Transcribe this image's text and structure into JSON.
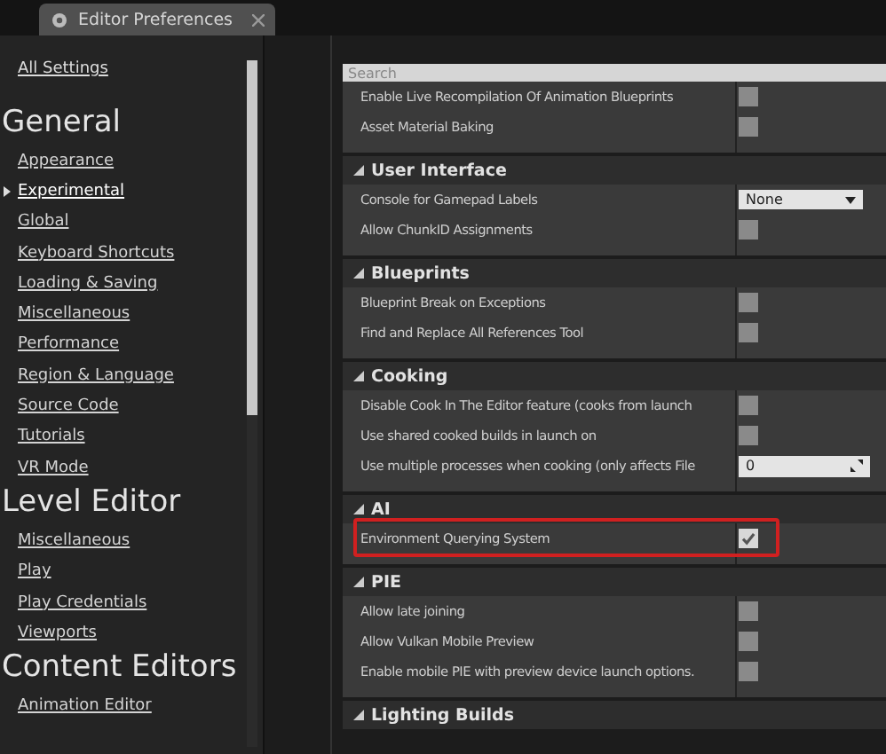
{
  "window": {
    "title": "Editor Preferences"
  },
  "sidebar": {
    "top_link": "All Settings",
    "groups": [
      {
        "heading": "General",
        "items": [
          {
            "label": "Appearance",
            "selected": false
          },
          {
            "label": "Experimental",
            "selected": true
          },
          {
            "label": "Global",
            "selected": false
          },
          {
            "label": "Keyboard Shortcuts",
            "selected": false
          },
          {
            "label": "Loading & Saving",
            "selected": false
          },
          {
            "label": "Miscellaneous",
            "selected": false
          },
          {
            "label": "Performance",
            "selected": false
          },
          {
            "label": "Region & Language",
            "selected": false
          },
          {
            "label": "Source Code",
            "selected": false
          },
          {
            "label": "Tutorials",
            "selected": false
          },
          {
            "label": "VR Mode",
            "selected": false
          }
        ]
      },
      {
        "heading": "Level Editor",
        "items": [
          {
            "label": "Miscellaneous",
            "selected": false
          },
          {
            "label": "Play",
            "selected": false
          },
          {
            "label": "Play Credentials",
            "selected": false
          },
          {
            "label": "Viewports",
            "selected": false
          }
        ]
      },
      {
        "heading": "Content Editors",
        "items": [
          {
            "label": "Animation Editor",
            "selected": false
          }
        ]
      }
    ]
  },
  "search": {
    "placeholder": "Search"
  },
  "sections": [
    {
      "rows": [
        {
          "label": "Enable Live Recompilation Of Animation Blueprints",
          "kind": "checkbox",
          "checked": false,
          "highlighted": false
        },
        {
          "label": "Asset Material Baking",
          "kind": "checkbox",
          "checked": false,
          "highlighted": false
        }
      ]
    },
    {
      "title": "User Interface",
      "rows": [
        {
          "label": "Console for Gamepad Labels",
          "kind": "dropdown",
          "value": "None",
          "highlighted": false
        },
        {
          "label": "Allow ChunkID Assignments",
          "kind": "checkbox",
          "checked": false,
          "highlighted": false
        }
      ]
    },
    {
      "title": "Blueprints",
      "rows": [
        {
          "label": "Blueprint Break on Exceptions",
          "kind": "checkbox",
          "checked": false,
          "highlighted": false
        },
        {
          "label": "Find and Replace All References Tool",
          "kind": "checkbox",
          "checked": false,
          "highlighted": false
        }
      ]
    },
    {
      "title": "Cooking",
      "rows": [
        {
          "label": "Disable Cook In The Editor feature (cooks from launch",
          "kind": "checkbox",
          "checked": false,
          "highlighted": false
        },
        {
          "label": "Use shared cooked builds in launch on",
          "kind": "checkbox",
          "checked": false,
          "highlighted": false
        },
        {
          "label": "Use multiple processes when cooking (only affects File",
          "kind": "number",
          "value": "0",
          "highlighted": false
        }
      ]
    },
    {
      "title": "AI",
      "rows": [
        {
          "label": "Environment Querying System",
          "kind": "checkbox",
          "checked": true,
          "highlighted": true
        }
      ]
    },
    {
      "title": "PIE",
      "rows": [
        {
          "label": "Allow late joining",
          "kind": "checkbox",
          "checked": false,
          "highlighted": false
        },
        {
          "label": "Allow Vulkan Mobile Preview",
          "kind": "checkbox",
          "checked": false,
          "highlighted": false
        },
        {
          "label": "Enable mobile PIE with preview device launch options.",
          "kind": "checkbox",
          "checked": false,
          "highlighted": false
        }
      ]
    },
    {
      "title": "Lighting Builds"
    }
  ]
}
